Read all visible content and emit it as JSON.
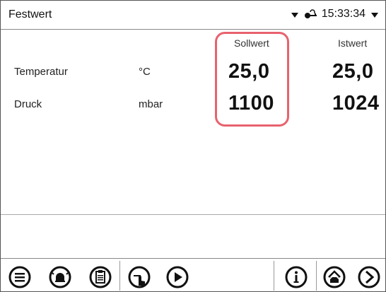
{
  "header": {
    "title": "Festwert",
    "time": "15:33:34"
  },
  "columns": {
    "setpoint": "Sollwert",
    "actual": "Istwert"
  },
  "rows": [
    {
      "label": "Temperatur",
      "unit": "°C",
      "setpoint": "25,0",
      "actual": "25,0"
    },
    {
      "label": "Druck",
      "unit": "mbar",
      "setpoint": "1100",
      "actual": "1024"
    }
  ],
  "colors": {
    "highlight": "#e8626e",
    "border": "#555555",
    "text": "#111111"
  },
  "toolbar": {
    "icons": [
      "menu-icon",
      "alarm-icon",
      "clipboard-icon",
      "touch-program-icon",
      "play-icon",
      "info-icon",
      "home-icon",
      "next-icon"
    ]
  }
}
